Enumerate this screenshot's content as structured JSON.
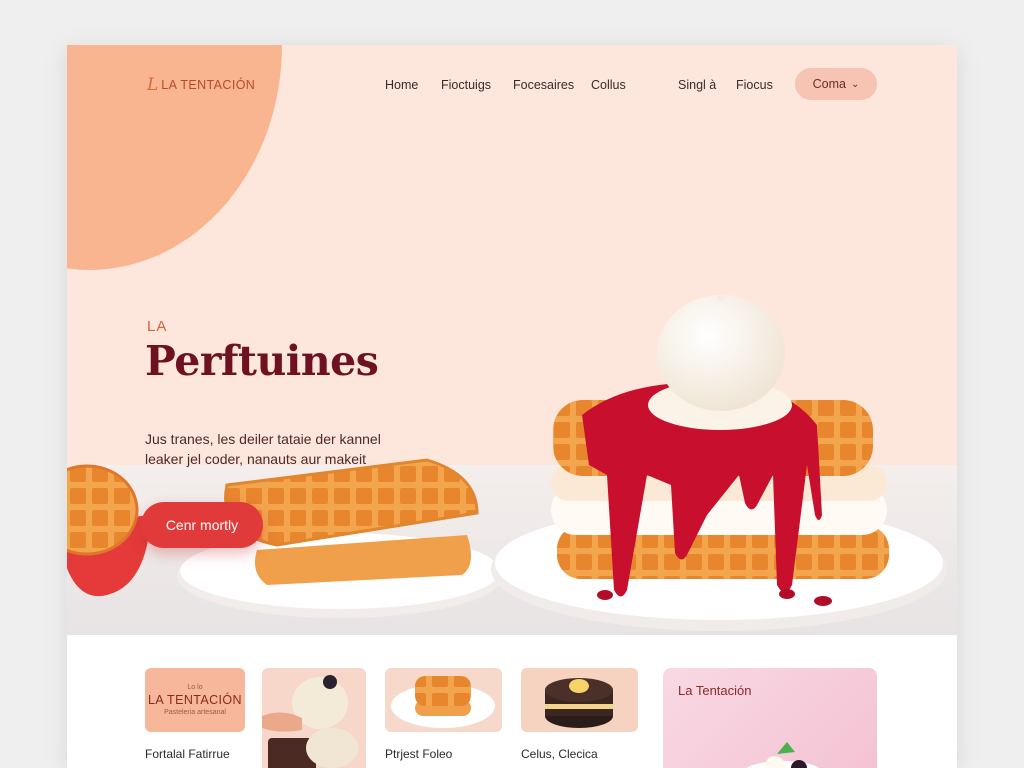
{
  "brand": {
    "logo_mark": "L",
    "name": "LA TENTACIÓN"
  },
  "nav": {
    "links": [
      "Home",
      "Fioctuigs",
      "Focesaires",
      "Collus",
      "Singl à",
      "Fiocus"
    ],
    "button_label": "Coma",
    "button_icon": "chevron-down-icon"
  },
  "hero": {
    "eyebrow": "LA",
    "headline": "Perftuines",
    "lead_lines": [
      "Jus tranes, les deiler tataie der kannel",
      "leaker jel coder, nanauts aur makeit"
    ],
    "cta_label": "Cenr mortly"
  },
  "cards": [
    {
      "caption": "Fortalal Fatirrue",
      "thumb": "brand",
      "thumb_small": "Lo lo",
      "thumb_big": "LA TENTACIÓN",
      "thumb_sub": "Pasteleria artesanal"
    },
    {
      "caption": "",
      "thumb": "ice-cream-dessert"
    },
    {
      "caption": "Ptrjest Foleo",
      "thumb": "waffle-plate"
    },
    {
      "caption": "Celus, Clecica",
      "thumb": "chocolate-cake"
    }
  ],
  "promo": {
    "title": "La Tentación"
  },
  "colors": {
    "hero_bg": "#fde6dc",
    "accent_orange": "#f8b58f",
    "headline": "#6e1222",
    "cta": "#e03a3a",
    "nav_button": "#f7c4b4"
  }
}
